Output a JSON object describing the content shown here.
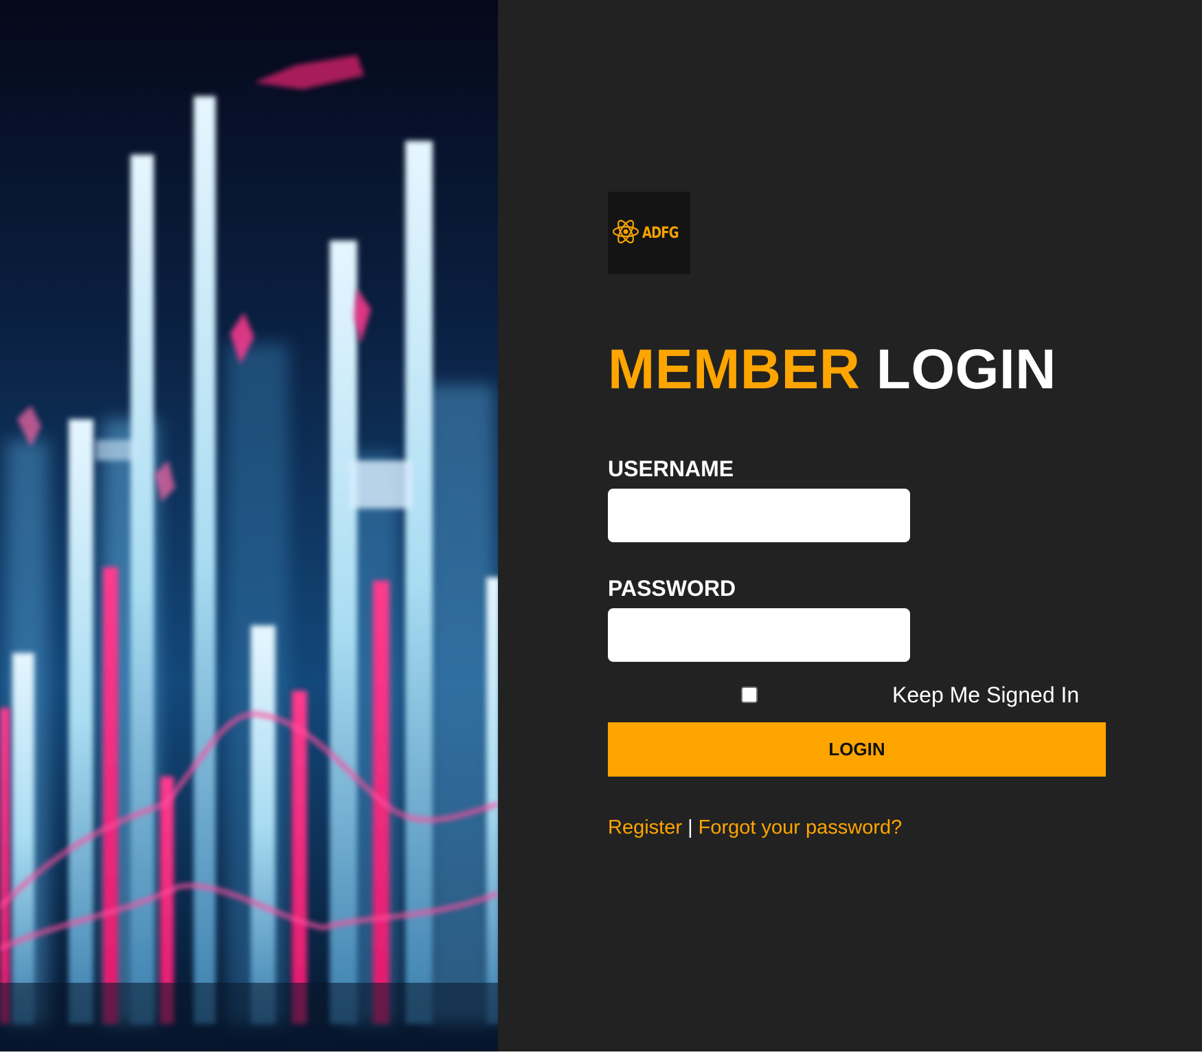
{
  "hero": {
    "description_icon": "financial-chart-image"
  },
  "logo": {
    "text": "ADFG",
    "icon": "atom-icon",
    "color": "#f5a300"
  },
  "heading": {
    "accent": "MEMBER",
    "main": "LOGIN"
  },
  "form": {
    "username_label": "USERNAME",
    "username_value": "",
    "password_label": "PASSWORD",
    "password_value": "",
    "keep_signed_in_label": "Keep Me Signed In",
    "keep_signed_in_checked": false,
    "login_button_label": "LOGIN"
  },
  "links": {
    "register": "Register",
    "separator": "|",
    "forgot": "Forgot your password?"
  },
  "colors": {
    "accent": "#ffa500",
    "panel": "#222222",
    "text": "#ffffff"
  }
}
